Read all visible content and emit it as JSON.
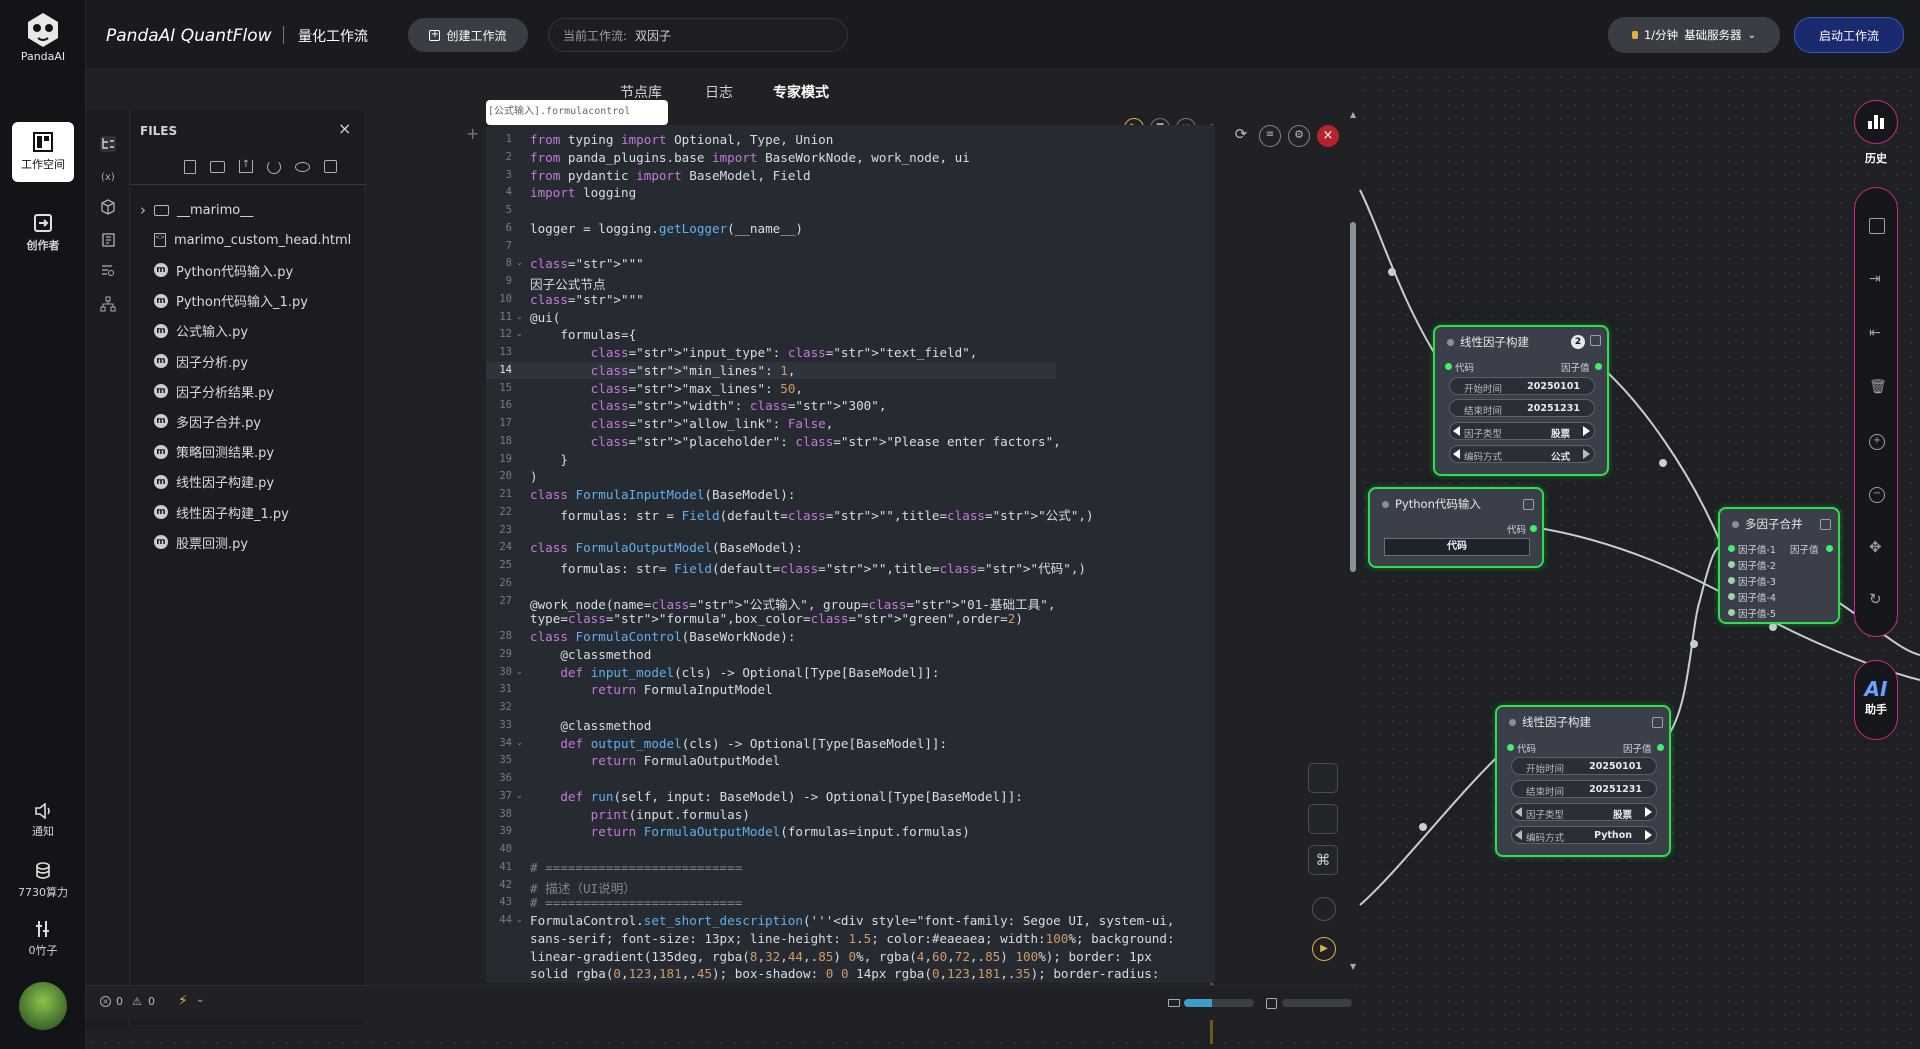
{
  "brand": {
    "logo_text": "PandaAI",
    "app_name": "PandaAI QuantFlow",
    "app_subtitle": "量化工作流"
  },
  "header": {
    "create_button": "创建工作流",
    "current_workflow_label": "当前工作流:",
    "current_workflow_value": "双因子",
    "rate_badge": "1/分钟",
    "server_label": "基础服务器",
    "start_button": "启动工作流"
  },
  "rail": {
    "workspace": "工作空间",
    "creator": "创作者",
    "notify": "通知",
    "compute": "7730算力",
    "bamboo": "0竹子"
  },
  "tabs": {
    "nodes": "节点库",
    "logs": "日志",
    "expert": "专家模式"
  },
  "files": {
    "title": "FILES",
    "items": [
      {
        "name": "__marimo__",
        "type": "folder"
      },
      {
        "name": "marimo_custom_head.html",
        "type": "html"
      },
      {
        "name": "Python代码输入.py",
        "type": "py"
      },
      {
        "name": "Python代码输入_1.py",
        "type": "py"
      },
      {
        "name": "公式输入.py",
        "type": "py"
      },
      {
        "name": "因子分析.py",
        "type": "py"
      },
      {
        "name": "因子分析结果.py",
        "type": "py"
      },
      {
        "name": "多因子合并.py",
        "type": "py"
      },
      {
        "name": "策略回测结果.py",
        "type": "py"
      },
      {
        "name": "线性因子构建.py",
        "type": "py"
      },
      {
        "name": "线性因子构建_1.py",
        "type": "py"
      },
      {
        "name": "股票回测.py",
        "type": "py"
      }
    ]
  },
  "editor": {
    "tab_hint": "[公式输入].formulacontrol",
    "lines": [
      "from typing import Optional, Type, Union",
      "from panda_plugins.base import BaseWorkNode, work_node, ui",
      "from pydantic import BaseModel, Field",
      "import logging",
      "",
      "logger = logging.getLogger(__name__)",
      "",
      "\"\"\"",
      "因子公式节点",
      "\"\"\"",
      "@ui(",
      "    formulas={",
      "        \"input_type\": \"text_field\",",
      "        \"min_lines\": 1,",
      "        \"max_lines\": 50,",
      "        \"width\": \"300\",",
      "        \"allow_link\": False,",
      "        \"placeholder\": \"Please enter factors\",",
      "    }",
      ")",
      "class FormulaInputModel(BaseModel):",
      "    formulas: str = Field(default=\"\",title=\"公式\",)",
      "",
      "class FormulaOutputModel(BaseModel):",
      "    formulas: str= Field(default=\"\",title=\"代码\",)",
      "",
      "@work_node(name=\"公式输入\", group=\"01-基础工具\",",
      "type=\"formula\",box_color=\"green\",order=2)",
      "class FormulaControl(BaseWorkNode):",
      "    @classmethod",
      "    def input_model(cls) -> Optional[Type[BaseModel]]:",
      "        return FormulaInputModel",
      "",
      "    @classmethod",
      "    def output_model(cls) -> Optional[Type[BaseModel]]:",
      "        return FormulaOutputModel",
      "",
      "    def run(self, input: BaseModel) -> Optional[Type[BaseModel]]:",
      "        print(input.formulas)",
      "        return FormulaOutputModel(formulas=input.formulas)",
      "",
      "# ==========================",
      "# 描述（UI说明）",
      "# ==========================",
      "FormulaControl.set_short_description('''<div style=\"font-family: Segoe UI, system-ui,",
      "sans-serif; font-size: 13px; line-height: 1.5; color:#eaeaea; width:100%; background:",
      "linear-gradient(135deg, rgba(8,32,44,.85) 0%, rgba(4,60,72,.85) 100%); border: 1px",
      "solid rgba(0,123,181,.45); box-shadow: 0 0 14px rgba(0,123,181,.35); border-radius:"
    ],
    "line_numbers": [
      "1",
      "2",
      "3",
      "4",
      "5",
      "6",
      "7",
      "8",
      "9",
      "10",
      "11",
      "12",
      "13",
      "14",
      "15",
      "16",
      "17",
      "18",
      "19",
      "20",
      "21",
      "22",
      "23",
      "24",
      "25",
      "26",
      "27",
      "",
      "28",
      "29",
      "30",
      "31",
      "32",
      "33",
      "34",
      "35",
      "36",
      "37",
      "38",
      "39",
      "40",
      "41",
      "42",
      "43",
      "44",
      "",
      "",
      ""
    ]
  },
  "status": {
    "errors": "0",
    "warnings": "0"
  },
  "right_sidebar": {
    "history": "历史",
    "assistant": "助手",
    "ai": "AI"
  },
  "nodes": {
    "linear1": {
      "title": "线性因子构建",
      "badge": "2",
      "in": "代码",
      "out": "因子值",
      "start_k": "开始时间",
      "start_v": "20250101",
      "end_k": "结束时间",
      "end_v": "20251231",
      "type_k": "因子类型",
      "type_v": "股票",
      "enc_k": "编码方式",
      "enc_v": "公式"
    },
    "pyinput": {
      "title": "Python代码输入",
      "out": "代码",
      "button": "代码"
    },
    "merge": {
      "title": "多因子合并",
      "out": "因子值",
      "inputs": [
        "因子值-1",
        "因子值-2",
        "因子值-3",
        "因子值-4",
        "因子值-5"
      ]
    },
    "linear2": {
      "title": "线性因子构建",
      "in": "代码",
      "out": "因子值",
      "start_k": "开始时间",
      "start_v": "20250101",
      "end_k": "结束时间",
      "end_v": "20251231",
      "type_k": "因子类型",
      "type_v": "股票",
      "enc_k": "编码方式",
      "enc_v": "Python"
    }
  },
  "colors": {
    "accent": "#2de04a",
    "brand_blue": "#1a2a6e",
    "pink": "#cc2a86"
  }
}
